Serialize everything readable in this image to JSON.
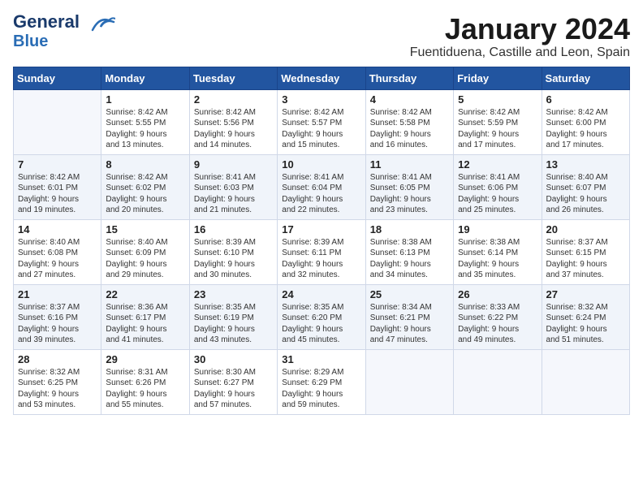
{
  "header": {
    "logo_line1": "General",
    "logo_line2": "Blue",
    "month_title": "January 2024",
    "subtitle": "Fuentiduena, Castille and Leon, Spain"
  },
  "weekdays": [
    "Sunday",
    "Monday",
    "Tuesday",
    "Wednesday",
    "Thursday",
    "Friday",
    "Saturday"
  ],
  "weeks": [
    [
      {
        "day": "",
        "info": ""
      },
      {
        "day": "1",
        "info": "Sunrise: 8:42 AM\nSunset: 5:55 PM\nDaylight: 9 hours\nand 13 minutes."
      },
      {
        "day": "2",
        "info": "Sunrise: 8:42 AM\nSunset: 5:56 PM\nDaylight: 9 hours\nand 14 minutes."
      },
      {
        "day": "3",
        "info": "Sunrise: 8:42 AM\nSunset: 5:57 PM\nDaylight: 9 hours\nand 15 minutes."
      },
      {
        "day": "4",
        "info": "Sunrise: 8:42 AM\nSunset: 5:58 PM\nDaylight: 9 hours\nand 16 minutes."
      },
      {
        "day": "5",
        "info": "Sunrise: 8:42 AM\nSunset: 5:59 PM\nDaylight: 9 hours\nand 17 minutes."
      },
      {
        "day": "6",
        "info": "Sunrise: 8:42 AM\nSunset: 6:00 PM\nDaylight: 9 hours\nand 17 minutes."
      }
    ],
    [
      {
        "day": "7",
        "info": "Sunrise: 8:42 AM\nSunset: 6:01 PM\nDaylight: 9 hours\nand 19 minutes."
      },
      {
        "day": "8",
        "info": "Sunrise: 8:42 AM\nSunset: 6:02 PM\nDaylight: 9 hours\nand 20 minutes."
      },
      {
        "day": "9",
        "info": "Sunrise: 8:41 AM\nSunset: 6:03 PM\nDaylight: 9 hours\nand 21 minutes."
      },
      {
        "day": "10",
        "info": "Sunrise: 8:41 AM\nSunset: 6:04 PM\nDaylight: 9 hours\nand 22 minutes."
      },
      {
        "day": "11",
        "info": "Sunrise: 8:41 AM\nSunset: 6:05 PM\nDaylight: 9 hours\nand 23 minutes."
      },
      {
        "day": "12",
        "info": "Sunrise: 8:41 AM\nSunset: 6:06 PM\nDaylight: 9 hours\nand 25 minutes."
      },
      {
        "day": "13",
        "info": "Sunrise: 8:40 AM\nSunset: 6:07 PM\nDaylight: 9 hours\nand 26 minutes."
      }
    ],
    [
      {
        "day": "14",
        "info": "Sunrise: 8:40 AM\nSunset: 6:08 PM\nDaylight: 9 hours\nand 27 minutes."
      },
      {
        "day": "15",
        "info": "Sunrise: 8:40 AM\nSunset: 6:09 PM\nDaylight: 9 hours\nand 29 minutes."
      },
      {
        "day": "16",
        "info": "Sunrise: 8:39 AM\nSunset: 6:10 PM\nDaylight: 9 hours\nand 30 minutes."
      },
      {
        "day": "17",
        "info": "Sunrise: 8:39 AM\nSunset: 6:11 PM\nDaylight: 9 hours\nand 32 minutes."
      },
      {
        "day": "18",
        "info": "Sunrise: 8:38 AM\nSunset: 6:13 PM\nDaylight: 9 hours\nand 34 minutes."
      },
      {
        "day": "19",
        "info": "Sunrise: 8:38 AM\nSunset: 6:14 PM\nDaylight: 9 hours\nand 35 minutes."
      },
      {
        "day": "20",
        "info": "Sunrise: 8:37 AM\nSunset: 6:15 PM\nDaylight: 9 hours\nand 37 minutes."
      }
    ],
    [
      {
        "day": "21",
        "info": "Sunrise: 8:37 AM\nSunset: 6:16 PM\nDaylight: 9 hours\nand 39 minutes."
      },
      {
        "day": "22",
        "info": "Sunrise: 8:36 AM\nSunset: 6:17 PM\nDaylight: 9 hours\nand 41 minutes."
      },
      {
        "day": "23",
        "info": "Sunrise: 8:35 AM\nSunset: 6:19 PM\nDaylight: 9 hours\nand 43 minutes."
      },
      {
        "day": "24",
        "info": "Sunrise: 8:35 AM\nSunset: 6:20 PM\nDaylight: 9 hours\nand 45 minutes."
      },
      {
        "day": "25",
        "info": "Sunrise: 8:34 AM\nSunset: 6:21 PM\nDaylight: 9 hours\nand 47 minutes."
      },
      {
        "day": "26",
        "info": "Sunrise: 8:33 AM\nSunset: 6:22 PM\nDaylight: 9 hours\nand 49 minutes."
      },
      {
        "day": "27",
        "info": "Sunrise: 8:32 AM\nSunset: 6:24 PM\nDaylight: 9 hours\nand 51 minutes."
      }
    ],
    [
      {
        "day": "28",
        "info": "Sunrise: 8:32 AM\nSunset: 6:25 PM\nDaylight: 9 hours\nand 53 minutes."
      },
      {
        "day": "29",
        "info": "Sunrise: 8:31 AM\nSunset: 6:26 PM\nDaylight: 9 hours\nand 55 minutes."
      },
      {
        "day": "30",
        "info": "Sunrise: 8:30 AM\nSunset: 6:27 PM\nDaylight: 9 hours\nand 57 minutes."
      },
      {
        "day": "31",
        "info": "Sunrise: 8:29 AM\nSunset: 6:29 PM\nDaylight: 9 hours\nand 59 minutes."
      },
      {
        "day": "",
        "info": ""
      },
      {
        "day": "",
        "info": ""
      },
      {
        "day": "",
        "info": ""
      }
    ]
  ]
}
